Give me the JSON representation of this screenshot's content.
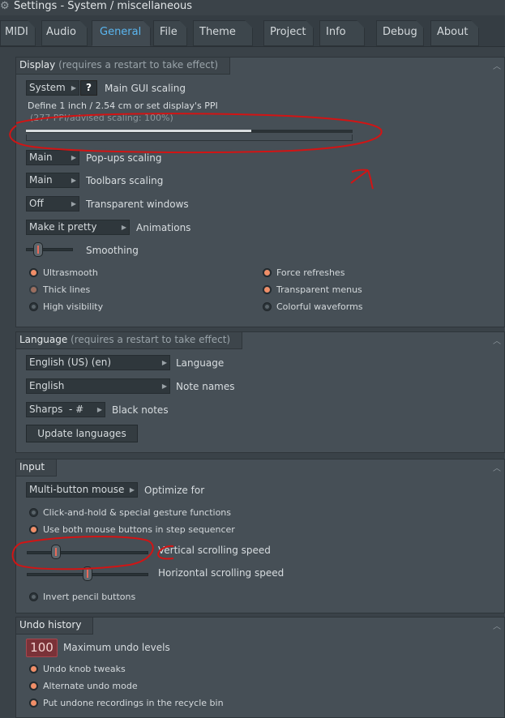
{
  "window": {
    "title": "Settings - System / miscellaneous"
  },
  "tabs": [
    "MIDI",
    "Audio",
    "General",
    "File",
    "Theme",
    "Project",
    "Info",
    "Debug",
    "About"
  ],
  "active_tab": "General",
  "display": {
    "header": "Display",
    "header_note": "(requires a restart to take effect)",
    "gui_scaling": {
      "value": "System",
      "help": "?",
      "label": "Main GUI scaling"
    },
    "ppi_text": "Define 1 inch / 2.54 cm or set display's PPI",
    "ppi_note": "(277 PPI/advised scaling: 100%)",
    "ppi_slider_fraction": 0.69,
    "popups": {
      "value": "Main",
      "label": "Pop-ups scaling"
    },
    "toolbars": {
      "value": "Main",
      "label": "Toolbars scaling"
    },
    "transparent": {
      "value": "Off",
      "label": "Transparent windows"
    },
    "animations": {
      "value": "Make it pretty",
      "label": "Animations"
    },
    "smoothing_label": "Smoothing",
    "options_left": [
      {
        "label": "Ultrasmooth",
        "state": "on"
      },
      {
        "label": "Thick lines",
        "state": "disabled"
      },
      {
        "label": "High visibility",
        "state": "off"
      }
    ],
    "options_right": [
      {
        "label": "Force refreshes",
        "state": "on"
      },
      {
        "label": "Transparent menus",
        "state": "on"
      },
      {
        "label": "Colorful waveforms",
        "state": "off"
      }
    ]
  },
  "language": {
    "header": "Language",
    "header_note": "(requires a restart to take effect)",
    "language": {
      "value": "English (US) (en)",
      "label": "Language"
    },
    "note_names": {
      "value": "English",
      "label": "Note names"
    },
    "black_notes": {
      "value": "Sharps  - #",
      "label": "Black notes"
    },
    "update_button": "Update languages"
  },
  "input": {
    "header": "Input",
    "optimize": {
      "value": "Multi-button mouse",
      "label": "Optimize for"
    },
    "options": [
      {
        "label": "Click-and-hold & special gesture functions",
        "state": "off"
      },
      {
        "label": "Use both mouse buttons in step sequencer",
        "state": "on"
      }
    ],
    "vertical_label": "Vertical scrolling speed",
    "vertical_level": 0.22,
    "horizontal_label": "Horizontal scrolling speed",
    "horizontal_level": 0.5,
    "invert_label": "Invert pencil buttons",
    "invert_state": "off"
  },
  "undo": {
    "header": "Undo history",
    "max_value": "100",
    "max_label": "Maximum undo levels",
    "options": [
      {
        "label": "Undo knob tweaks",
        "state": "on"
      },
      {
        "label": "Alternate undo mode",
        "state": "on"
      },
      {
        "label": "Put undone recordings in the recycle bin",
        "state": "on"
      }
    ]
  },
  "colors": {
    "accent": "#5ab6f0",
    "radio_on": "#f08e68",
    "annotation": "#d21414"
  },
  "icons": {
    "window": "gear-icon",
    "dropdown": "triangle-right-icon",
    "collapse": "chevron-up-icon"
  }
}
